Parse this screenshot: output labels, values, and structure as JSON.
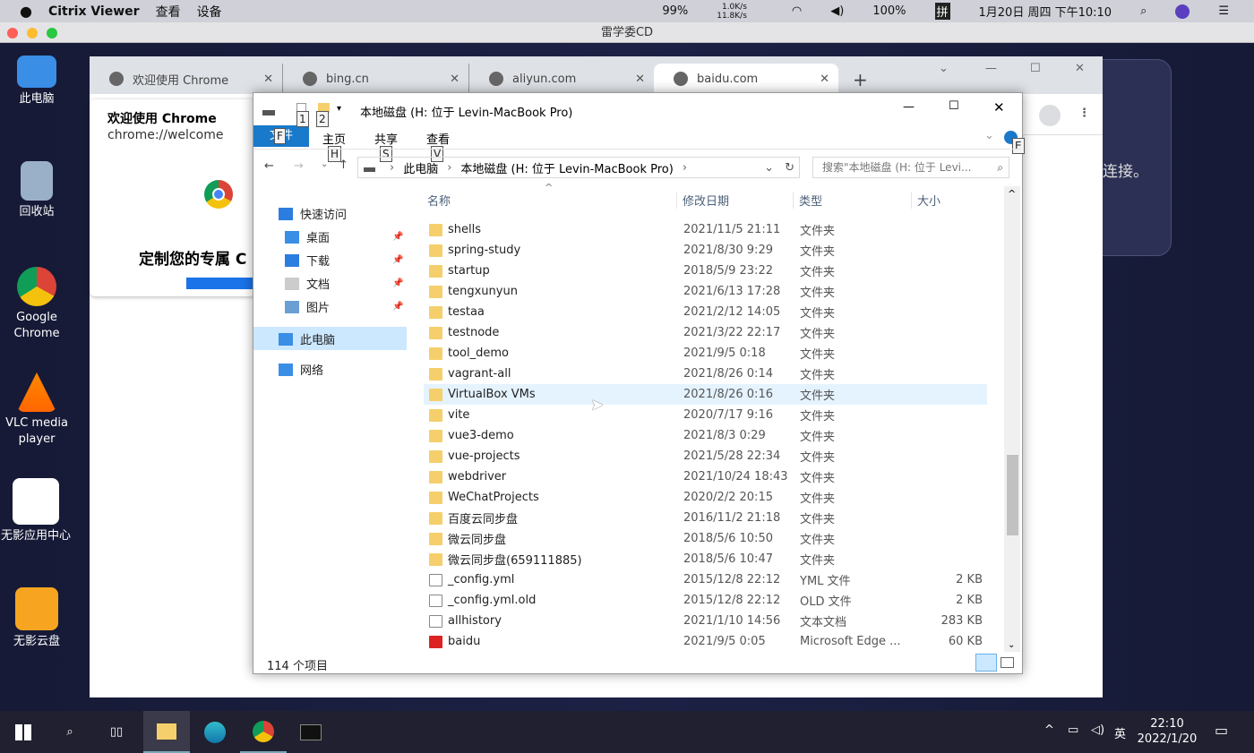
{
  "mac_menu": {
    "app": "Citrix Viewer",
    "items": [
      "查看",
      "设备"
    ],
    "battery_small": "99%",
    "net_up": "1.0K/s",
    "net_down": "11.8K/s",
    "battery": "100%",
    "ime": "拼",
    "clock": "1月20日 周四 下午10:10"
  },
  "citrix": {
    "title": "雷学委CD"
  },
  "desktop": {
    "icons": [
      "此电脑",
      "回收站",
      "Google Chrome",
      "VLC media player",
      "无影应用中心",
      "无影云盘"
    ]
  },
  "chrome": {
    "tabs": [
      "欢迎使用 Chrome",
      "bing.cn",
      "aliyun.com",
      "baidu.com"
    ],
    "active_tab": 3,
    "welcome_card": {
      "title": "欢迎使用 Chrome",
      "url": "chrome://welcome",
      "heading": "定制您的专属 C"
    },
    "side_text": "连接。"
  },
  "explorer": {
    "title": "本地磁盘 (H: 位于 Levin-MacBook Pro)",
    "ribbon_tabs": [
      "文件",
      "主页",
      "共享",
      "查看"
    ],
    "keytips": {
      "file": "F",
      "home": "H",
      "share": "S",
      "view": "V",
      "qa1": "1",
      "qa2": "2",
      "help": "E"
    },
    "breadcrumb": [
      "此电脑",
      "本地磁盘 (H: 位于 Levin-MacBook Pro)"
    ],
    "search_placeholder": "搜索\"本地磁盘 (H: 位于 Levi...",
    "columns": [
      "名称",
      "修改日期",
      "类型",
      "大小"
    ],
    "nav": [
      {
        "label": "快速访问"
      },
      {
        "label": "桌面"
      },
      {
        "label": "下载"
      },
      {
        "label": "文档"
      },
      {
        "label": "图片"
      },
      {
        "label": "此电脑"
      },
      {
        "label": "网络"
      }
    ],
    "files": [
      {
        "name": "shells",
        "date": "2021/11/5 21:11",
        "type": "文件夹",
        "size": "",
        "kind": "folder"
      },
      {
        "name": "spring-study",
        "date": "2021/8/30 9:29",
        "type": "文件夹",
        "size": "",
        "kind": "folder"
      },
      {
        "name": "startup",
        "date": "2018/5/9 23:22",
        "type": "文件夹",
        "size": "",
        "kind": "folder"
      },
      {
        "name": "tengxunyun",
        "date": "2021/6/13 17:28",
        "type": "文件夹",
        "size": "",
        "kind": "folder"
      },
      {
        "name": "testaa",
        "date": "2021/2/12 14:05",
        "type": "文件夹",
        "size": "",
        "kind": "folder"
      },
      {
        "name": "testnode",
        "date": "2021/3/22 22:17",
        "type": "文件夹",
        "size": "",
        "kind": "folder"
      },
      {
        "name": "tool_demo",
        "date": "2021/9/5 0:18",
        "type": "文件夹",
        "size": "",
        "kind": "folder"
      },
      {
        "name": "vagrant-all",
        "date": "2021/8/26 0:14",
        "type": "文件夹",
        "size": "",
        "kind": "folder"
      },
      {
        "name": "VirtualBox VMs",
        "date": "2021/8/26 0:16",
        "type": "文件夹",
        "size": "",
        "kind": "folder",
        "hover": true
      },
      {
        "name": "vite",
        "date": "2020/7/17 9:16",
        "type": "文件夹",
        "size": "",
        "kind": "folder"
      },
      {
        "name": "vue3-demo",
        "date": "2021/8/3 0:29",
        "type": "文件夹",
        "size": "",
        "kind": "folder"
      },
      {
        "name": "vue-projects",
        "date": "2021/5/28 22:34",
        "type": "文件夹",
        "size": "",
        "kind": "folder"
      },
      {
        "name": "webdriver",
        "date": "2021/10/24 18:43",
        "type": "文件夹",
        "size": "",
        "kind": "folder"
      },
      {
        "name": "WeChatProjects",
        "date": "2020/2/2 20:15",
        "type": "文件夹",
        "size": "",
        "kind": "folder"
      },
      {
        "name": "百度云同步盘",
        "date": "2016/11/2 21:18",
        "type": "文件夹",
        "size": "",
        "kind": "folder"
      },
      {
        "name": "微云同步盘",
        "date": "2018/5/6 10:50",
        "type": "文件夹",
        "size": "",
        "kind": "folder"
      },
      {
        "name": "微云同步盘(659111885)",
        "date": "2018/5/6 10:47",
        "type": "文件夹",
        "size": "",
        "kind": "folder"
      },
      {
        "name": "_config.yml",
        "date": "2015/12/8 22:12",
        "type": "YML 文件",
        "size": "2 KB",
        "kind": "file"
      },
      {
        "name": "_config.yml.old",
        "date": "2015/12/8 22:12",
        "type": "OLD 文件",
        "size": "2 KB",
        "kind": "file"
      },
      {
        "name": "allhistory",
        "date": "2021/1/10 14:56",
        "type": "文本文档",
        "size": "283 KB",
        "kind": "file"
      },
      {
        "name": "baidu",
        "date": "2021/9/5 0:05",
        "type": "Microsoft Edge ...",
        "size": "60 KB",
        "kind": "pdf"
      }
    ],
    "status": "114 个项目"
  },
  "taskbar": {
    "ime": "英",
    "time": "22:10",
    "date": "2022/1/20"
  }
}
